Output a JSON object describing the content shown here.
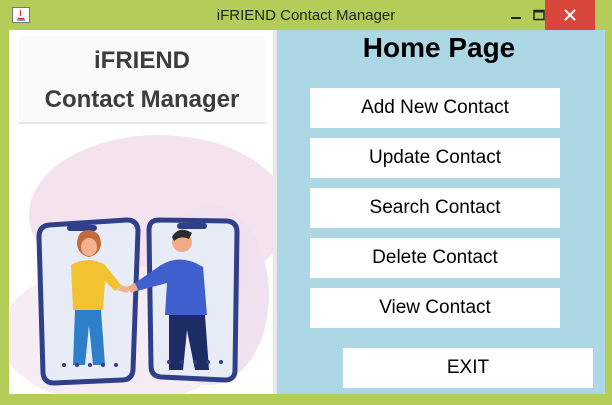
{
  "window": {
    "title": "iFRIEND Contact Manager",
    "titlebar_color": "#b3cd58",
    "close_color": "#d9463b",
    "controls": [
      "minimize-icon",
      "maximize-icon",
      "close-icon"
    ]
  },
  "brand": {
    "line1": "iFRIEND",
    "line2": "Contact Manager"
  },
  "main": {
    "heading": "Home Page",
    "background": "#acd8e5",
    "buttons": {
      "add": "Add New Contact",
      "update": "Update Contact",
      "search": "Search Contact",
      "delete": "Delete Contact",
      "view": "View Contact",
      "exit": "EXIT"
    }
  }
}
